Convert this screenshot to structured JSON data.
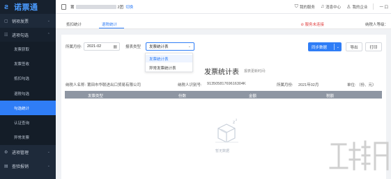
{
  "sidebar": {
    "logo": "诺票通",
    "groups": [
      {
        "label": "销项发票",
        "icon": "file-icon"
      },
      {
        "label": "进项勾选",
        "icon": "check-list-icon",
        "open": true
      },
      {
        "label": "进项管理",
        "icon": "gear-icon"
      },
      {
        "label": "查验报销",
        "icon": "receipt-icon"
      }
    ],
    "items": [
      {
        "label": "发票获取"
      },
      {
        "label": "发票签收"
      },
      {
        "label": "抵扣勾选"
      },
      {
        "label": "退税勾选"
      },
      {
        "label": "勾选统计",
        "active": true
      },
      {
        "label": "认证查询"
      },
      {
        "label": "异常发票"
      }
    ]
  },
  "topbar": {
    "company_prefix": "莆",
    "company_suffix": "2团",
    "switch_label": "切换",
    "actions": [
      {
        "label": "我的服务",
        "icon": "shield-icon"
      },
      {
        "label": "消息中心",
        "icon": "bell-icon"
      },
      {
        "label": "我的企业",
        "icon": "user-icon"
      }
    ],
    "window_glyph": "一 口"
  },
  "tabs": {
    "items": [
      {
        "label": "抵扣统计"
      },
      {
        "label": "退税统计",
        "active": true
      }
    ],
    "service_hint": "服务未连接",
    "taxpayer_label": "纳税人等级："
  },
  "filters": {
    "month_label": "所属月份:",
    "month_value": "2021-02",
    "type_label": "报表类型",
    "type_value": "发票统计表",
    "options": [
      "发票统计表",
      "异常发票统计表"
    ]
  },
  "buttons": {
    "sync": "同步数据",
    "export": "导出",
    "print": "打印"
  },
  "report": {
    "title": "发票统计表",
    "subtitle": "报表更新时间:",
    "taxpayer_name_label": "纳税人名称:",
    "taxpayer_name": "莆田市华联进出口贸易有限公司",
    "taxpayer_id_label": "纳税人识别号:",
    "taxpayer_id": "91350581769616304K",
    "period_label": "所属月份:",
    "period": "2021年02月",
    "unit": "单位: （份、元）"
  },
  "table": {
    "columns": [
      "发票类型",
      "份数",
      "金额",
      "税额"
    ],
    "empty_text": "暂无数据"
  },
  "colors": {
    "primary": "#2f7df6",
    "sidebar": "#1e2a3a",
    "header_gray": "#8e96a3",
    "alert_red": "#e04040"
  }
}
